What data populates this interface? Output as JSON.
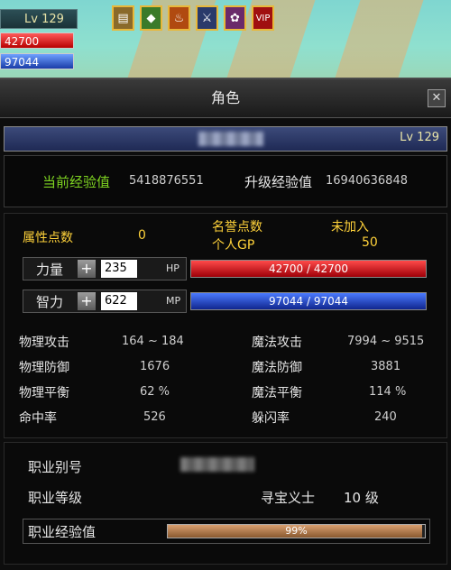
{
  "hud": {
    "level": "Lv 129",
    "hp": "42700",
    "mp": "97044",
    "buffs": [
      {
        "icon": "scroll-icon",
        "color": "#8a6a2a"
      },
      {
        "icon": "gem-icon",
        "color": "#3a7a2a"
      },
      {
        "icon": "fire-icon",
        "color": "#b04a10"
      },
      {
        "icon": "sword-icon",
        "color": "#2a3a6a"
      },
      {
        "icon": "potion-icon",
        "color": "#6a2a6a"
      },
      {
        "icon": "vip-icon",
        "color": "#a01010",
        "text": "VIP"
      }
    ]
  },
  "window": {
    "title": "角色",
    "close_label": "✕",
    "level": "Lv 129"
  },
  "exp": {
    "current_label": "当前经验值",
    "current_value": "5418876551",
    "next_label": "升级经验值",
    "next_value": "16940636848"
  },
  "attributes": {
    "points_label": "属性点数",
    "points_value": "0",
    "honor_label": "名誉点数",
    "honor_value": "未加入",
    "gp_label": "个人GP",
    "gp_value": "50",
    "str_label": "力量",
    "str_value": "235",
    "int_label": "智力",
    "int_value": "622",
    "add_label": "+",
    "hp_label": "HP",
    "hp_text": "42700 / 42700",
    "hp_fraction": 1.0,
    "mp_label": "MP",
    "mp_text": "97044 / 97044",
    "mp_fraction": 1.0
  },
  "combat": [
    {
      "label": "物理攻击",
      "value": "164 ~ 184",
      "label2": "魔法攻击",
      "value2": "7994 ~ 9515"
    },
    {
      "label": "物理防御",
      "value": "1676",
      "label2": "魔法防御",
      "value2": "3881"
    },
    {
      "label": "物理平衡",
      "value": "62 %",
      "label2": "魔法平衡",
      "value2": "114 %"
    },
    {
      "label": "命中率",
      "value": "526",
      "label2": "躲闪率",
      "value2": "240"
    }
  ],
  "job": {
    "alias_label": "职业别号",
    "rank_label": "职业等级",
    "class_name": "寻宝义士",
    "rank_value": "10 级",
    "exp_label": "职业经验值",
    "exp_text": "99%",
    "exp_fraction": 0.99
  },
  "colors": {
    "hp_bar": "#c8121c",
    "mp_bar": "#1e3cc8",
    "label_green": "#7ed321",
    "label_yellow": "#ffd23a"
  }
}
